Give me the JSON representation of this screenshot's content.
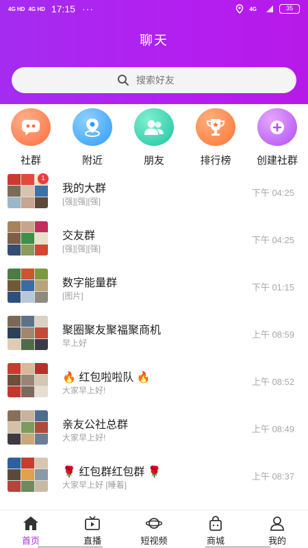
{
  "status_bar": {
    "signal1": "4G HD",
    "signal2": "4G HD",
    "time": "17:15",
    "dots": "···",
    "network": "4G",
    "battery": "35"
  },
  "header": {
    "title": "聊天"
  },
  "search": {
    "placeholder": "搜索好友"
  },
  "features": [
    {
      "label": "社群",
      "icon": "chat-bubble-icon",
      "color": "#fd6d3e"
    },
    {
      "label": "附近",
      "icon": "location-pin-icon",
      "color": "#2f9cf8"
    },
    {
      "label": "朋友",
      "icon": "friends-icon",
      "color": "#1ec4a0"
    },
    {
      "label": "排行榜",
      "icon": "trophy-icon",
      "color": "#fd7334"
    },
    {
      "label": "创建社群",
      "icon": "add-circle-icon",
      "color": "#b14df2"
    }
  ],
  "chats": [
    {
      "name": "我的大群",
      "message": "[强][强][强]",
      "time": "下午 04:25",
      "badge": "1"
    },
    {
      "name": "交友群",
      "message": "[强][强][强]",
      "time": "下午 04:25"
    },
    {
      "name": "数字能量群",
      "message": "[图片]",
      "time": "下午 01:15"
    },
    {
      "name": "聚圈聚友聚福聚商机",
      "message": "早上好",
      "time": "上午 08:59"
    },
    {
      "name": "🔥 红包啦啦队 🔥",
      "message": "大家早上好!",
      "time": "上午 08:52"
    },
    {
      "name": "亲友公社总群",
      "message": "大家早上好!",
      "time": "上午 08:49"
    },
    {
      "name": "🌹 红包群红包群 🌹",
      "message": "大家早上好 [睡着]",
      "time": "上午 08:37"
    }
  ],
  "tabs": [
    {
      "label": "首页",
      "icon": "home-icon",
      "active": true
    },
    {
      "label": "直播",
      "icon": "tv-icon"
    },
    {
      "label": "短视频",
      "icon": "planet-icon"
    },
    {
      "label": "商城",
      "icon": "shopping-bag-icon"
    },
    {
      "label": "我的",
      "icon": "user-icon"
    }
  ],
  "colors": {
    "header": "#a42cf0",
    "accent": "#a42cf0",
    "badge": "#f03a3a"
  }
}
